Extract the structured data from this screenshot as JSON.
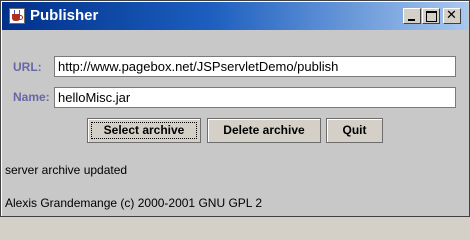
{
  "window": {
    "title": "Publisher",
    "controls": {
      "minimize": "minimize-icon",
      "maximize": "maximize-icon",
      "close": "close-icon"
    }
  },
  "form": {
    "url_label": "URL:",
    "url_value": "http://www.pagebox.net/JSPservletDemo/publish",
    "name_label": "Name:",
    "name_value": "helloMisc.jar"
  },
  "buttons": {
    "select": "Select archive",
    "delete": "Delete archive",
    "quit": "Quit"
  },
  "status": {
    "message": "server archive updated",
    "copyright": "Alexis Grandemange (c) 2000-2001 GNU GPL 2"
  },
  "colors": {
    "label": "#6767a8",
    "titlebar_start": "#00308a",
    "titlebar_end": "#a9c8ef"
  }
}
